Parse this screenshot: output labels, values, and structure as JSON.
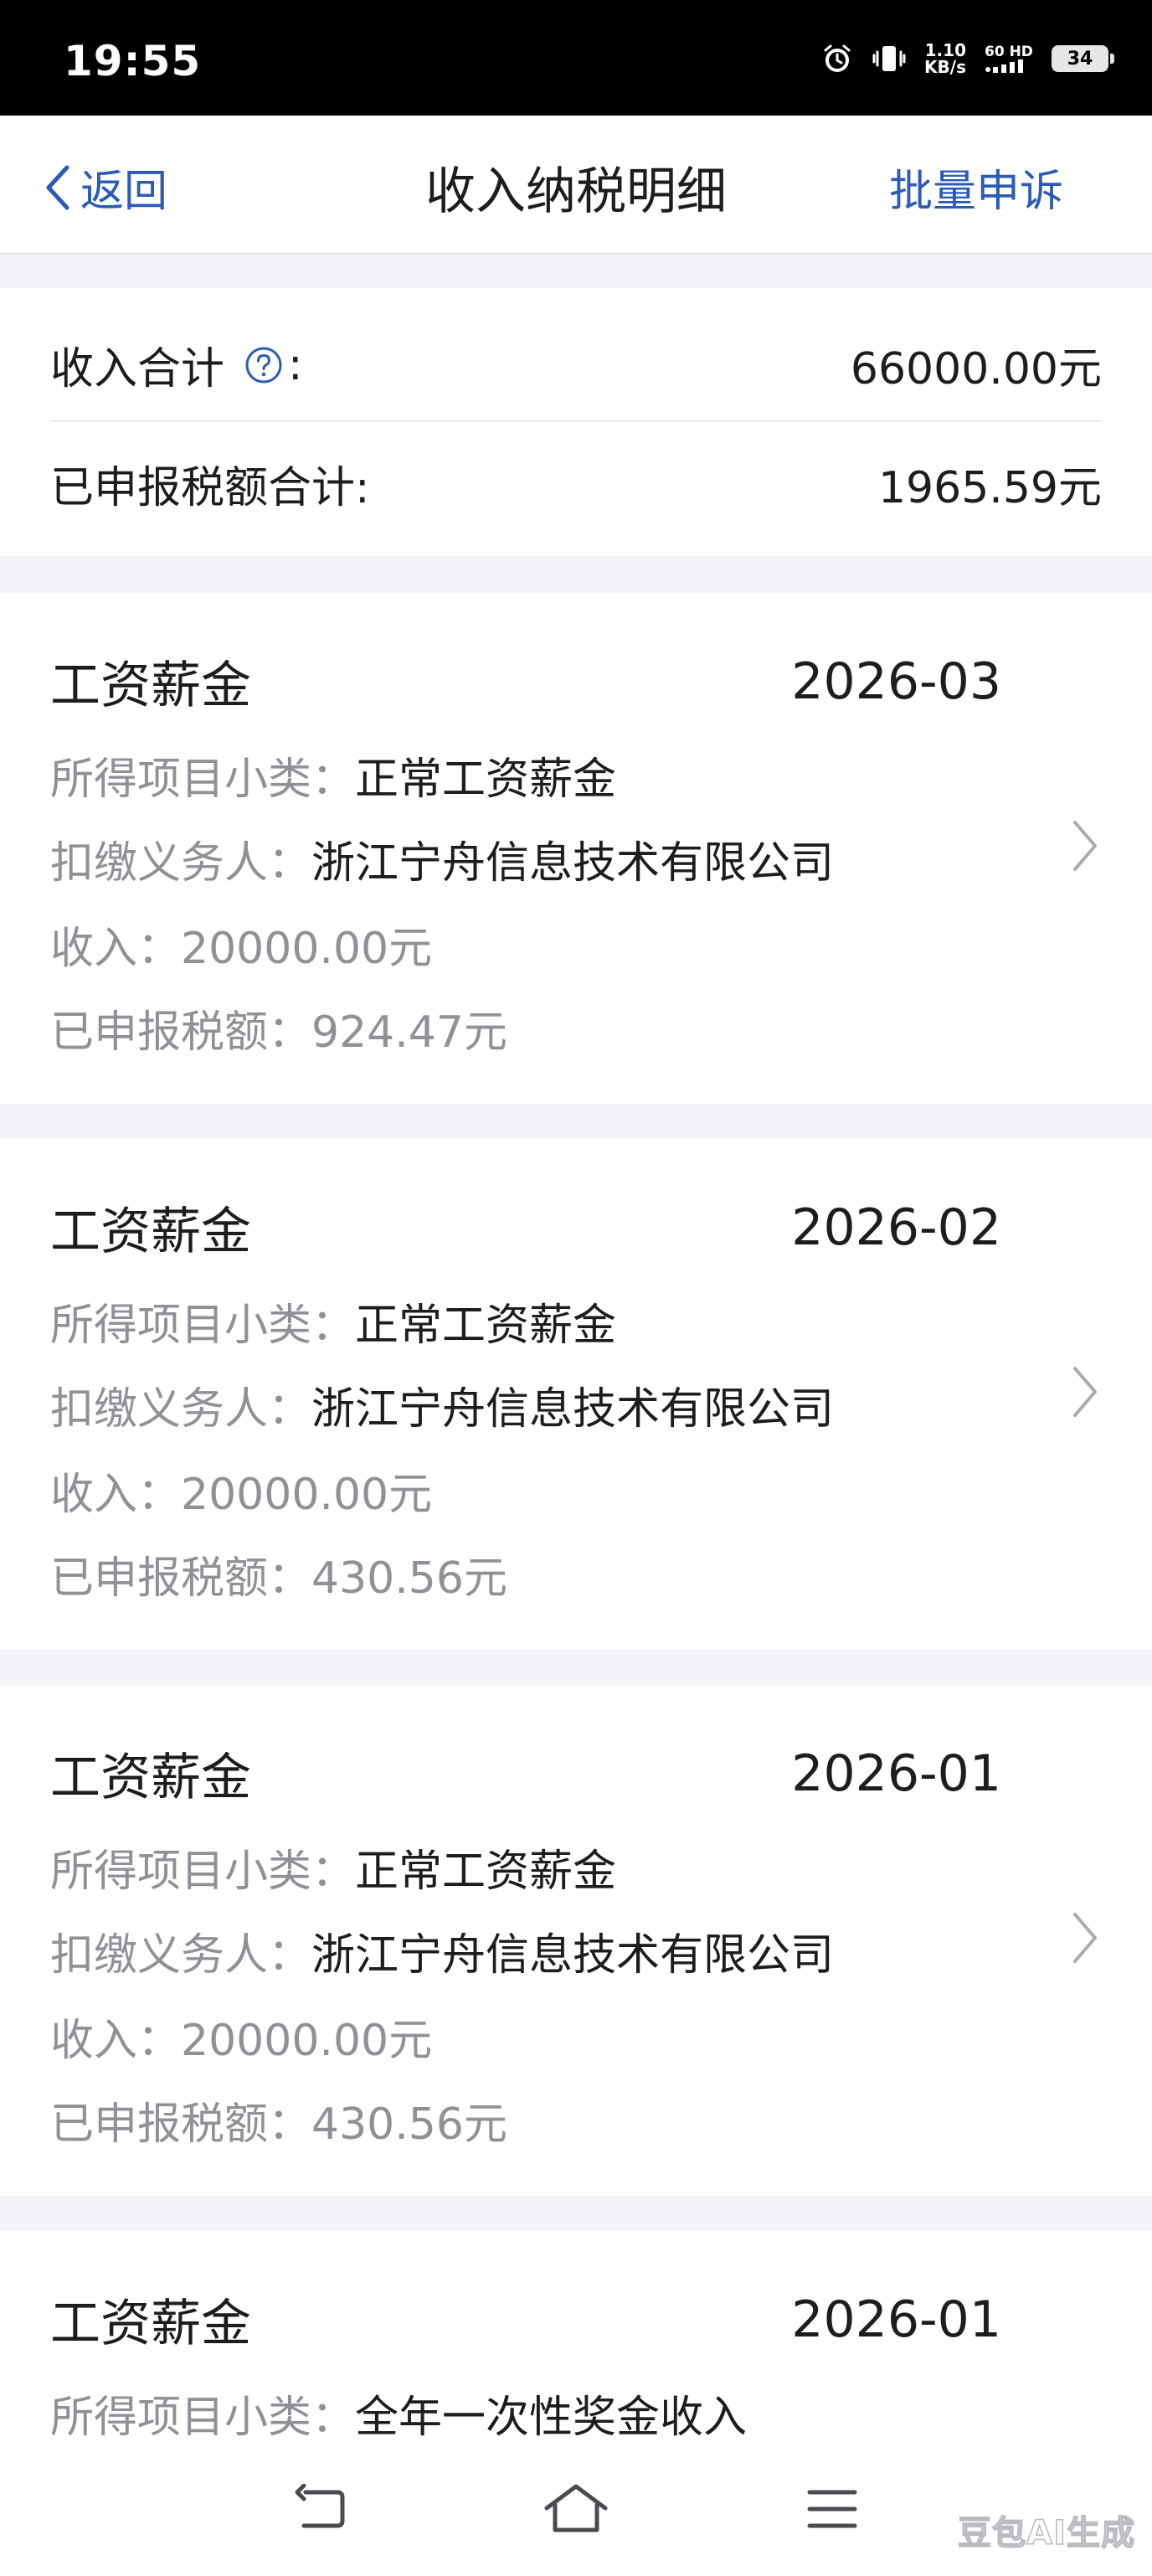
{
  "status_bar": {
    "time": "19:55",
    "net_speed_value": "1.10",
    "net_speed_unit": "KB/s",
    "net_type_top": "60 HD",
    "battery": "34"
  },
  "nav": {
    "back_label": "返回",
    "title": "收入纳税明细",
    "action_label": "批量申诉"
  },
  "summary": {
    "income_label": "收入合计",
    "income_colon": ":",
    "income_value": "66000.00元",
    "tax_label": "已申报税额合计:",
    "tax_value": "1965.59元"
  },
  "field_labels": {
    "subcategory": "所得项目小类：",
    "withholder": "扣缴义务人：",
    "income": "收入：",
    "tax": "已申报税额："
  },
  "records": [
    {
      "category": "工资薪金",
      "period": "2026-03",
      "subcategory": "正常工资薪金",
      "withholder": "浙江宁舟信息技术有限公司",
      "income": "20000.00元",
      "tax": "924.47元"
    },
    {
      "category": "工资薪金",
      "period": "2026-02",
      "subcategory": "正常工资薪金",
      "withholder": "浙江宁舟信息技术有限公司",
      "income": "20000.00元",
      "tax": "430.56元"
    },
    {
      "category": "工资薪金",
      "period": "2026-01",
      "subcategory": "正常工资薪金",
      "withholder": "浙江宁舟信息技术有限公司",
      "income": "20000.00元",
      "tax": "430.56元"
    },
    {
      "category": "工资薪金",
      "period": "2026-01",
      "subcategory": "全年一次性奖金收入"
    }
  ],
  "watermark": "豆包AI生成",
  "icons": {
    "back": "chevron-left-icon",
    "help": "question-circle-icon",
    "row_arrow": "chevron-right-icon",
    "sys_back": "return-arrow-icon",
    "sys_home": "home-icon",
    "sys_menu": "menu-icon"
  },
  "colors": {
    "accent": "#2a5bb6",
    "secondary_text": "#8f9196",
    "page_bg": "#f4f5f9"
  }
}
